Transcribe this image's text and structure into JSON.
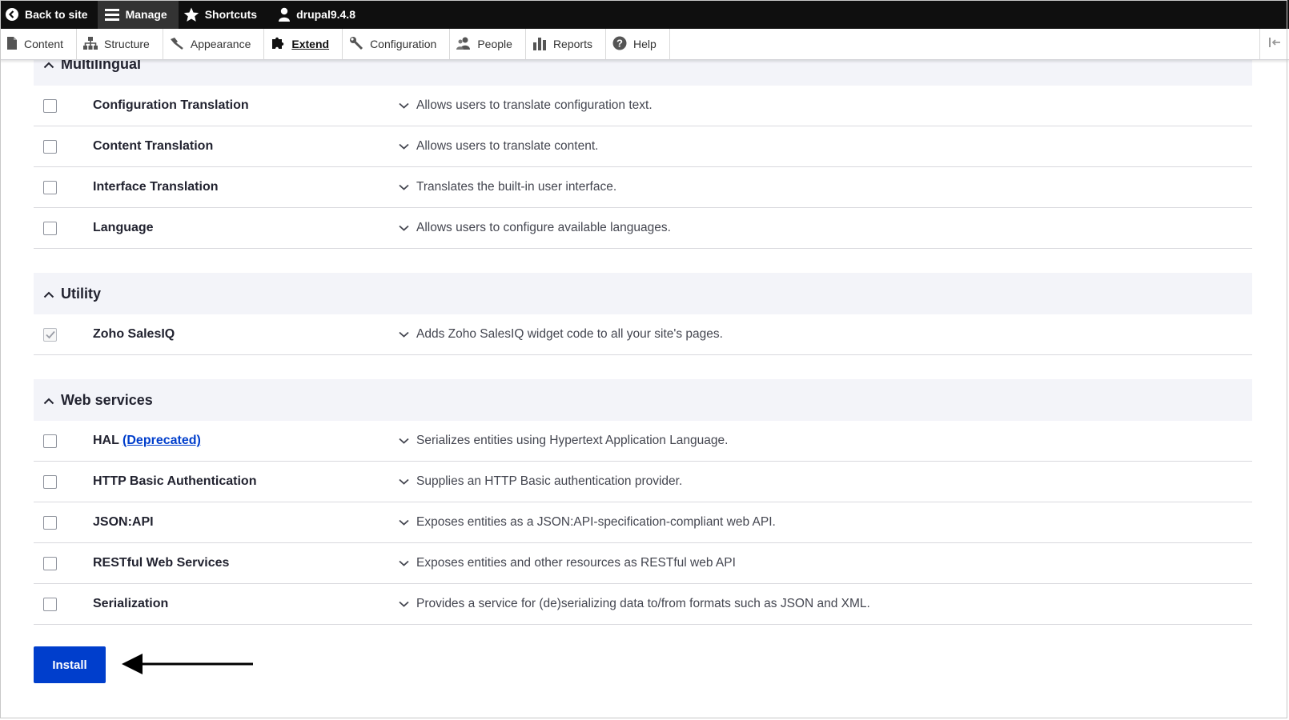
{
  "toolbar": {
    "back_to_site": "Back to site",
    "manage": "Manage",
    "shortcuts": "Shortcuts",
    "user": "drupal9.4.8"
  },
  "tray": {
    "items": [
      {
        "label": "Content",
        "icon": "file-icon"
      },
      {
        "label": "Structure",
        "icon": "sitemap-icon"
      },
      {
        "label": "Appearance",
        "icon": "paintbrush-icon"
      },
      {
        "label": "Extend",
        "icon": "puzzle-icon",
        "active": true
      },
      {
        "label": "Configuration",
        "icon": "wrench-icon"
      },
      {
        "label": "People",
        "icon": "people-icon"
      },
      {
        "label": "Reports",
        "icon": "bar-chart-icon"
      },
      {
        "label": "Help",
        "icon": "help-icon"
      }
    ]
  },
  "groups": {
    "multilingual": {
      "title": "Multilingual",
      "modules": [
        {
          "name": "Configuration Translation",
          "description": "Allows users to translate configuration text.",
          "checked": false
        },
        {
          "name": "Content Translation",
          "description": "Allows users to translate content.",
          "checked": false
        },
        {
          "name": "Interface Translation",
          "description": "Translates the built-in user interface.",
          "checked": false
        },
        {
          "name": "Language",
          "description": "Allows users to configure available languages.",
          "checked": false
        }
      ]
    },
    "utility": {
      "title": "Utility",
      "modules": [
        {
          "name": "Zoho SalesIQ",
          "description": "Adds Zoho SalesIQ widget code to all your site's pages.",
          "checked": true
        }
      ]
    },
    "web_services": {
      "title": "Web services",
      "modules": [
        {
          "name": "HAL",
          "link": "(Deprecated)",
          "description": "Serializes entities using Hypertext Application Language.",
          "checked": false
        },
        {
          "name": "HTTP Basic Authentication",
          "description": "Supplies an HTTP Basic authentication provider.",
          "checked": false
        },
        {
          "name": "JSON:API",
          "description": "Exposes entities as a JSON:API-specification-compliant web API.",
          "checked": false
        },
        {
          "name": "RESTful Web Services",
          "description": "Exposes entities and other resources as RESTful web API",
          "checked": false
        },
        {
          "name": "Serialization",
          "description": "Provides a service for (de)serializing data to/from formats such as JSON and XML.",
          "checked": false
        }
      ]
    }
  },
  "install_label": "Install",
  "colors": {
    "primary": "#003ecc",
    "toolbar_bg": "#0f0f0f",
    "group_bg": "#f3f4f9"
  }
}
